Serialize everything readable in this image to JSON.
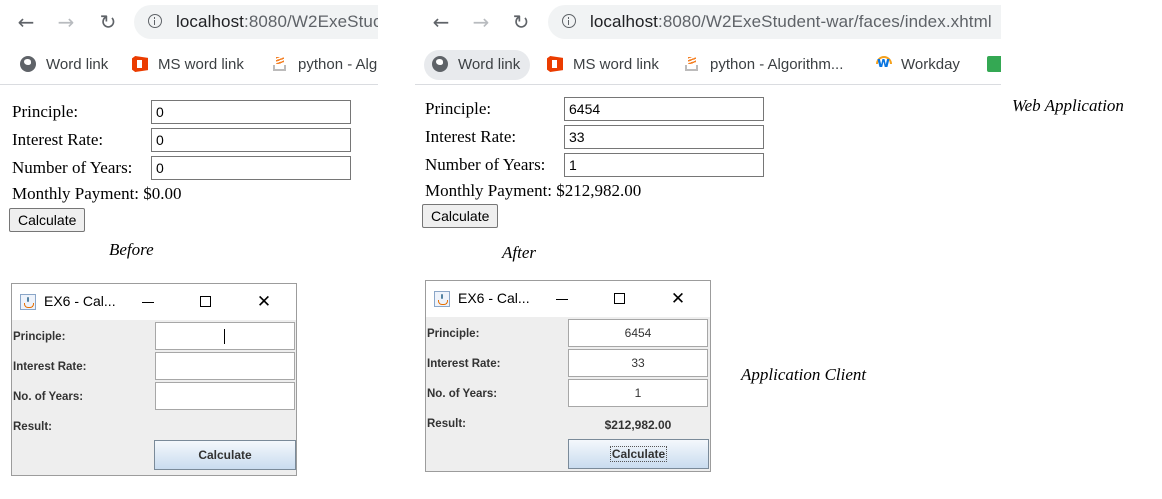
{
  "browser_left": {
    "url_host": "localhost",
    "url_path": ":8080/W2ExeStuc",
    "bookmarks": [
      "Word link",
      "MS word link",
      "python - Alg"
    ]
  },
  "browser_right": {
    "url_host": "localhost",
    "url_path": ":8080/W2ExeStudent-war/faces/index.xhtml",
    "bookmarks": [
      "Word link",
      "MS word link",
      "python - Algorithm...",
      "Workday"
    ]
  },
  "nav": {
    "back": "←",
    "forward": "→",
    "reload": "↻"
  },
  "web_labels": {
    "principle": "Principle:",
    "rate": "Interest Rate:",
    "years": "Number of Years:",
    "monthly": "Monthly Payment:",
    "calculate": "Calculate"
  },
  "web_before": {
    "principle": "0",
    "rate": "0",
    "years": "0",
    "monthly": "$0.00"
  },
  "web_after": {
    "principle": "6454",
    "rate": "33",
    "years": "1",
    "monthly": "$212,982.00"
  },
  "captions": {
    "before": "Before",
    "after": "After",
    "web_app": "Web Application",
    "app_client": "Application Client"
  },
  "swing_labels": {
    "principle": "Principle:",
    "rate": "Interest Rate:",
    "years": "No. of Years:",
    "result": "Result:",
    "calculate": "Calculate"
  },
  "swing_before": {
    "title": "EX6 - Cal...",
    "principle": "",
    "rate": "",
    "years": "",
    "result": ""
  },
  "swing_after": {
    "title": "EX6 - Cal...",
    "principle": "6454",
    "rate": "33",
    "years": "1",
    "result": "$212,982.00"
  },
  "window_controls": {
    "close": "✕"
  }
}
